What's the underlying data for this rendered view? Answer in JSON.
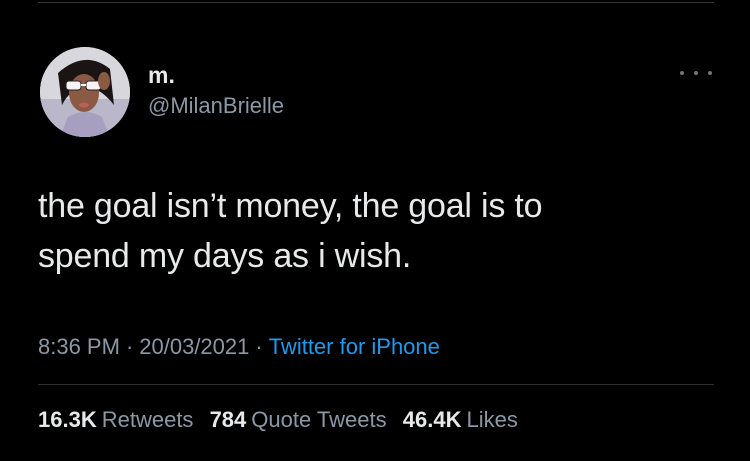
{
  "user": {
    "display_name": "m.",
    "handle": "@MilanBrielle",
    "avatar_icon": "profile-photo-avatar"
  },
  "tweet": {
    "text_lines": [
      "the goal isn’t money, the goal is to",
      "spend my days as i wish."
    ],
    "time": "8:36 PM",
    "date": "20/03/2021",
    "separator": "·",
    "source": "Twitter for iPhone"
  },
  "stats": {
    "retweets_count": "16.3K",
    "retweets_label": "Retweets",
    "quotes_count": "784",
    "quotes_label": "Quote Tweets",
    "likes_count": "46.4K",
    "likes_label": "Likes"
  },
  "menu": {
    "icon": "more-options-icon"
  },
  "colors": {
    "background": "#000000",
    "primary_text": "#e7e9ea",
    "secondary_text": "#8b98a5",
    "accent": "#1d9bf0",
    "divider": "#2f3336"
  }
}
